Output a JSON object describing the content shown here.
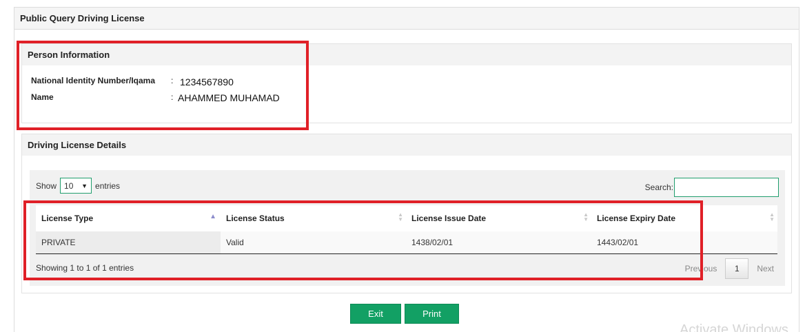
{
  "page_title": "Public Query Driving License",
  "person": {
    "heading": "Person Information",
    "id_label": "National Identity Number/Iqama",
    "id_colon": ":",
    "id_value": "1234567890",
    "name_label": "Name",
    "name_colon": ":",
    "name_value": "AHAMMED MUHAMAD"
  },
  "license": {
    "heading": "Driving License Details",
    "show_label": "Show",
    "entries_value": "10",
    "entries_label": "entries",
    "search_label": "Search:",
    "search_value": "",
    "columns": [
      "License Type",
      "License Status",
      "License Issue Date",
      "License Expiry Date"
    ],
    "rows": [
      [
        "PRIVATE",
        "Valid",
        "1438/02/01",
        "1443/02/01"
      ]
    ],
    "info_text": "Showing 1 to 1 of 1 entries",
    "previous": "Previous",
    "current_page": "1",
    "next": "Next"
  },
  "buttons": {
    "exit": "Exit",
    "print": "Print"
  },
  "watermark": "Activate Windows",
  "colors": {
    "accent_green": "#12a064",
    "highlight_red": "#e02027"
  }
}
